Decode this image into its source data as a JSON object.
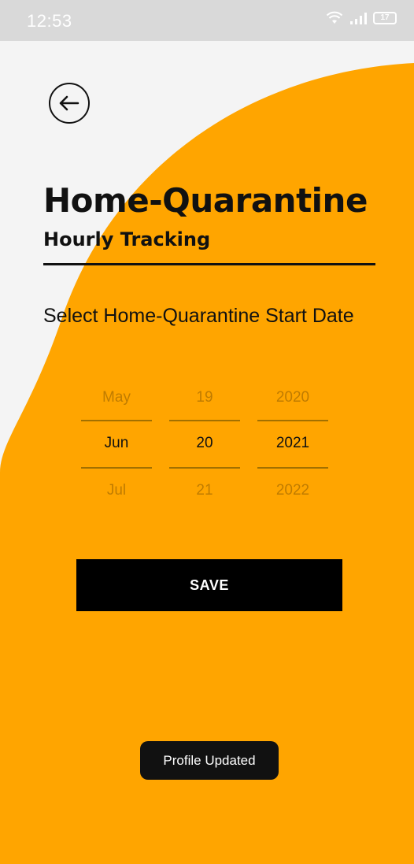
{
  "status_bar": {
    "time": "12:53",
    "battery_level": "17",
    "icons": [
      "wifi-icon",
      "signal-icon",
      "battery-icon"
    ]
  },
  "colors": {
    "accent": "#FFA500",
    "background": "#F4F4F4",
    "button": "#000000",
    "text": "#111111"
  },
  "header": {
    "title": "Home-Quarantine",
    "subtitle": "Hourly Tracking",
    "back_icon": "arrow-left-circle-icon"
  },
  "form": {
    "prompt": "Select Home-Quarantine Start Date",
    "date_picker": {
      "month": {
        "prev": "May",
        "selected": "Jun",
        "next": "Jul"
      },
      "day": {
        "prev": "19",
        "selected": "20",
        "next": "21"
      },
      "year": {
        "prev": "2020",
        "selected": "2021",
        "next": "2022"
      }
    },
    "save_label": "SAVE"
  },
  "toast": {
    "message": "Profile Updated"
  }
}
